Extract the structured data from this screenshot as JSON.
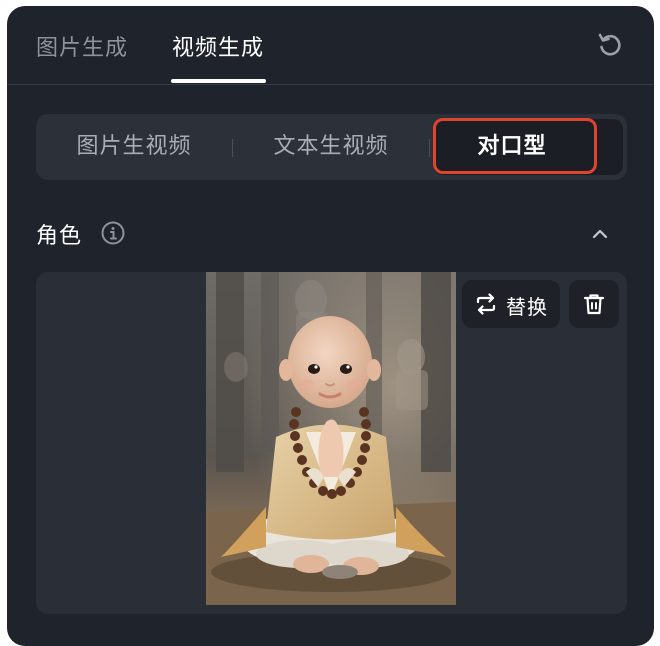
{
  "top_tabs": [
    {
      "label": "图片生成",
      "active": false
    },
    {
      "label": "视频生成",
      "active": true
    }
  ],
  "mode_tabs": [
    {
      "label": "图片生视频",
      "selected": false
    },
    {
      "label": "文本生视频",
      "selected": false
    },
    {
      "label": "对口型",
      "selected": true
    }
  ],
  "role_section": {
    "title": "角色",
    "info_icon": "info-icon",
    "collapse_icon": "chevron-up-icon",
    "replace_label": "替换",
    "replace_icon": "swap-icon",
    "delete_icon": "trash-icon"
  },
  "colors": {
    "panel_bg": "#1f232b",
    "highlight_outline": "#e0442e",
    "active_text": "#ffffff",
    "inactive_text": "#8d929c"
  }
}
